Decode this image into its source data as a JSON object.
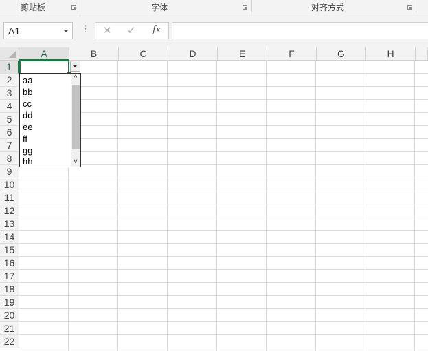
{
  "ribbon": {
    "groups": [
      "剪贴板",
      "字体",
      "对齐方式"
    ]
  },
  "formula_bar": {
    "name_box": "A1",
    "cancel_icon": "✕",
    "enter_icon": "✓",
    "fx_label": "fx",
    "formula": ""
  },
  "sheet": {
    "columns": [
      "A",
      "B",
      "C",
      "D",
      "E",
      "F",
      "G",
      "H"
    ],
    "rows": [
      "1",
      "2",
      "3",
      "4",
      "5",
      "6",
      "7",
      "8",
      "9",
      "10",
      "11",
      "12",
      "13",
      "14",
      "15",
      "16",
      "17",
      "18",
      "19",
      "20",
      "21",
      "22"
    ],
    "active_cell": "A1"
  },
  "dropdown": {
    "items": [
      "aa",
      "bb",
      "cc",
      "dd",
      "ee",
      "ff",
      "gg",
      "hh"
    ],
    "scroll_up": "^",
    "scroll_down": "v"
  },
  "colors": {
    "accent": "#217346"
  }
}
